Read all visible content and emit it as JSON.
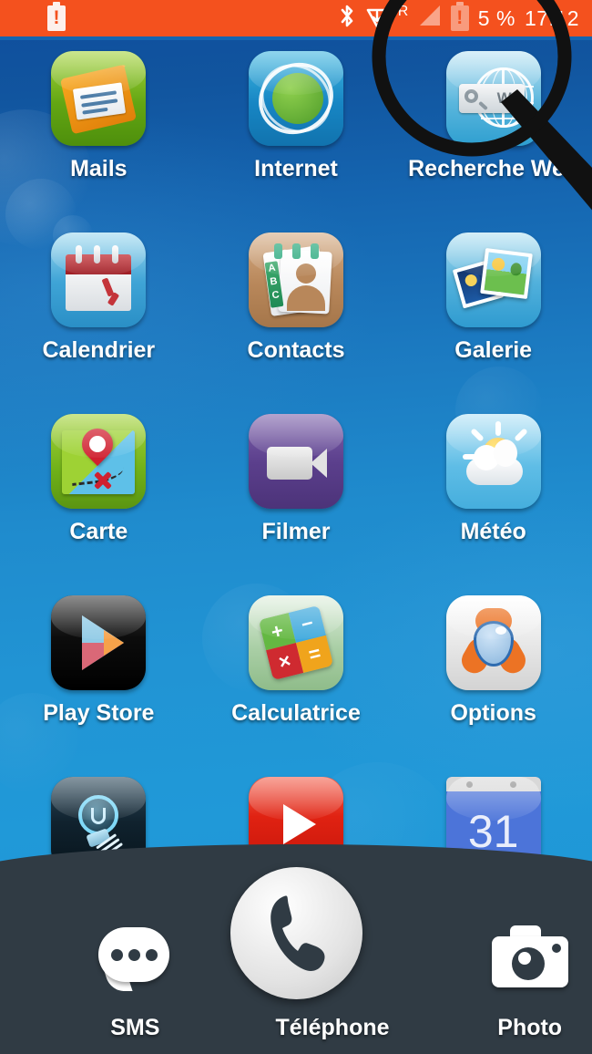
{
  "status_bar": {
    "background_color": "#f4511e",
    "left_icon": "battery-warning-icon",
    "icons": [
      "bluetooth-icon",
      "wifi-download-icon",
      "roaming-icon",
      "signal-bars-icon",
      "battery-low-icon"
    ],
    "roaming_label": "R",
    "battery_percent": "5 %",
    "clock": "17:12"
  },
  "home_screen": {
    "wallpaper_colors": [
      "#0f4d9c",
      "#2099d8"
    ],
    "rows": [
      [
        {
          "label": "Mails",
          "icon": "mails-icon"
        },
        {
          "label": "Internet",
          "icon": "internet-icon"
        },
        {
          "label": "Recherche Web",
          "icon": "web-search-icon",
          "search_box_text": "W"
        }
      ],
      [
        {
          "label": "Calendrier",
          "icon": "calendar-icon"
        },
        {
          "label": "Contacts",
          "icon": "contacts-icon",
          "tab_letters": [
            "A",
            "B",
            "C"
          ]
        },
        {
          "label": "Galerie",
          "icon": "gallery-icon"
        }
      ],
      [
        {
          "label": "Carte",
          "icon": "map-icon"
        },
        {
          "label": "Filmer",
          "icon": "camcorder-icon"
        },
        {
          "label": "Météo",
          "icon": "weather-icon"
        }
      ],
      [
        {
          "label": "Play Store",
          "icon": "play-store-icon"
        },
        {
          "label": "Calculatrice",
          "icon": "calculator-icon",
          "keys": [
            "+",
            "−",
            "×",
            "="
          ]
        },
        {
          "label": "Options",
          "icon": "options-icon"
        }
      ],
      [
        {
          "label": "",
          "icon": "flashlight-icon"
        },
        {
          "label": "",
          "icon": "youtube-icon"
        },
        {
          "label": "",
          "icon": "google-calendar-icon",
          "day_number": "31"
        }
      ]
    ]
  },
  "dock": {
    "background_color": "#303b44",
    "items": [
      {
        "label": "SMS",
        "icon": "sms-bubble-icon"
      },
      {
        "label": "Téléphone",
        "icon": "phone-handset-icon"
      },
      {
        "label": "Photo",
        "icon": "camera-icon"
      }
    ]
  },
  "overlay": {
    "magnifier": "magnifying-glass-overlay",
    "color": "#111111"
  }
}
